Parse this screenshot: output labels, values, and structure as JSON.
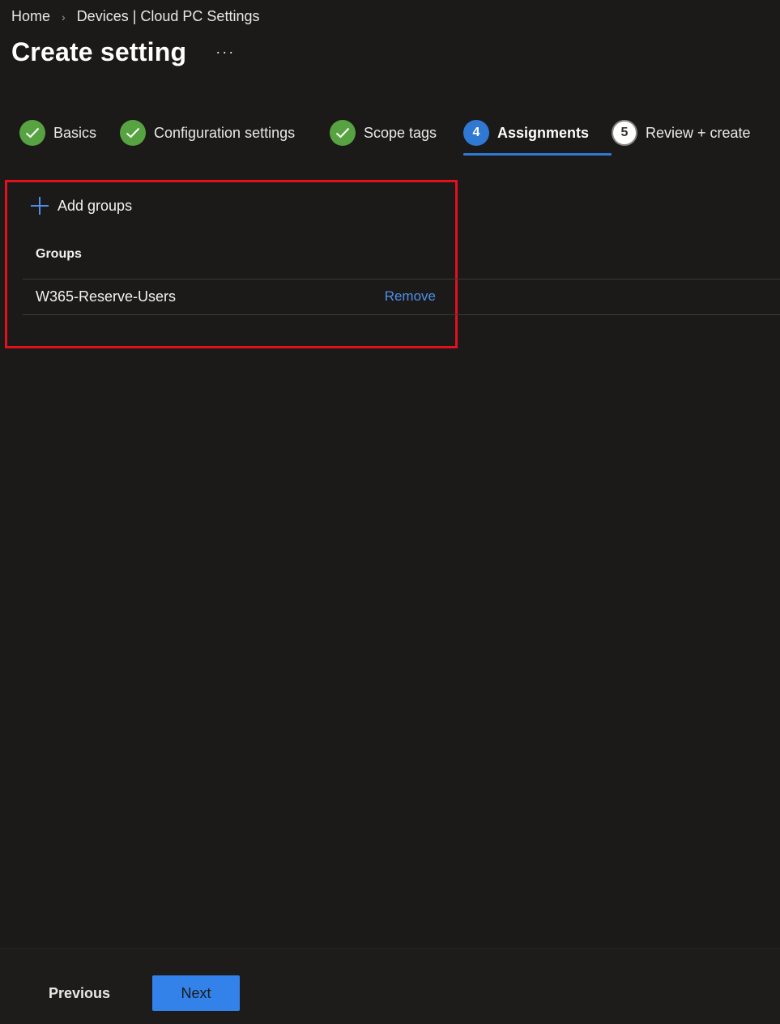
{
  "breadcrumb": {
    "home": "Home",
    "devices": "Devices | Cloud PC Settings"
  },
  "header": {
    "title": "Create setting",
    "more": "···"
  },
  "steps": [
    {
      "label": "Basics",
      "state": "done"
    },
    {
      "label": "Configuration settings",
      "state": "done"
    },
    {
      "label": "Scope tags",
      "state": "done"
    },
    {
      "label": "Assignments",
      "number": "4",
      "state": "current"
    },
    {
      "label": "Review + create",
      "number": "5",
      "state": "todo"
    }
  ],
  "assignments": {
    "add_groups_label": "Add groups",
    "groups_header": "Groups",
    "groups": [
      {
        "name": "W365-Reserve-Users",
        "action": "Remove"
      }
    ]
  },
  "footer": {
    "previous_label": "Previous",
    "next_label": "Next"
  },
  "colors": {
    "background": "#1b1a19",
    "accent": "#2f78d4",
    "success": "#57a341",
    "highlight": "#e3101d",
    "link": "#4f8ee8"
  }
}
